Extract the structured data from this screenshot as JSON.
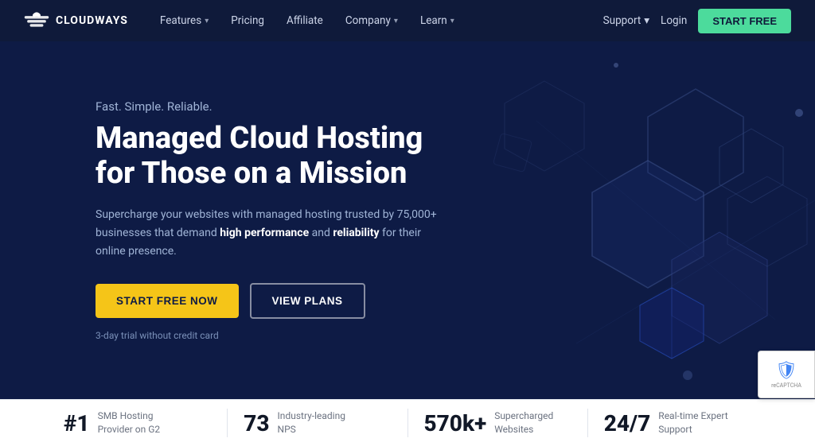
{
  "navbar": {
    "logo_text": "CLOUDWAYS",
    "nav_items": [
      {
        "label": "Features",
        "has_dropdown": true
      },
      {
        "label": "Pricing",
        "has_dropdown": false
      },
      {
        "label": "Affiliate",
        "has_dropdown": false
      },
      {
        "label": "Company",
        "has_dropdown": true
      },
      {
        "label": "Learn",
        "has_dropdown": true
      }
    ],
    "support_label": "Support",
    "login_label": "Login",
    "start_free_label": "START FREE"
  },
  "hero": {
    "tagline": "Fast. Simple. Reliable.",
    "title": "Managed Cloud Hosting for Those on a Mission",
    "description_part1": "Supercharge your websites with managed hosting trusted by 75,000+ businesses that demand ",
    "description_bold1": "high performance",
    "description_part2": " and ",
    "description_bold2": "reliability",
    "description_part3": " for their online presence.",
    "btn_start_free_now": "START FREE NOW",
    "btn_view_plans": "VIEW PLANS",
    "trial_text": "3-day trial without credit card"
  },
  "stats": [
    {
      "number": "#1",
      "desc": "SMB Hosting Provider on G2"
    },
    {
      "number": "73",
      "desc": "Industry-leading NPS"
    },
    {
      "number": "570k+",
      "desc": "Supercharged Websites"
    },
    {
      "number": "24/7",
      "desc": "Real-time Expert Support"
    }
  ],
  "colors": {
    "bg_dark": "#0e1b45",
    "accent_green": "#4cdb9c",
    "accent_yellow": "#f5c518"
  }
}
